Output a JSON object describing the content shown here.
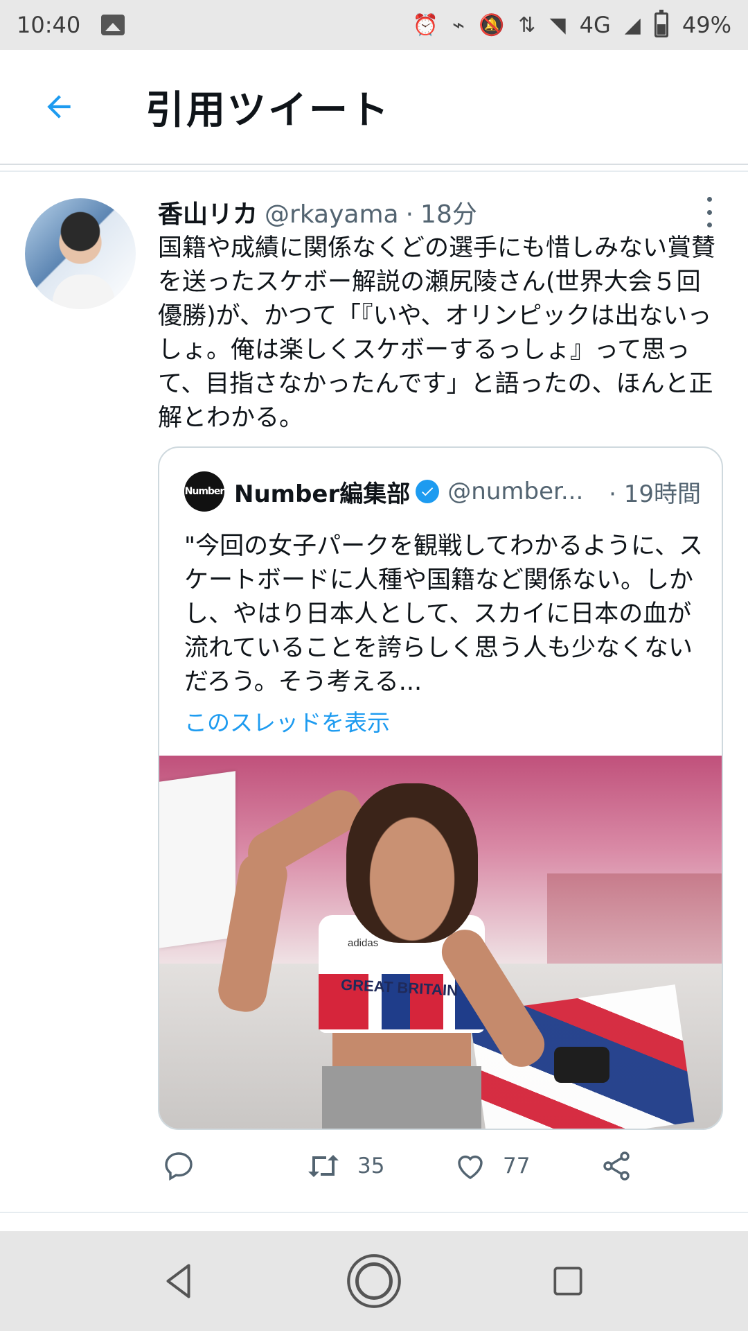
{
  "status_bar": {
    "time": "10:40",
    "network": "4G",
    "battery": "49%",
    "battery_level": 0.49,
    "icons": [
      "gallery-icon",
      "alarm-icon",
      "nfc-icon",
      "notifications-off-icon",
      "data-arrows-icon",
      "wifi-icon",
      "signal-icon",
      "battery-icon"
    ]
  },
  "header": {
    "title": "引用ツイート",
    "back_icon": "arrow-left-icon"
  },
  "tweet": {
    "author_name": "香山リカ",
    "author_handle": "@rkayama",
    "separator": "·",
    "time_ago": "18分",
    "text": "国籍や成績に関係なくどの選手にも惜しみない賞賛を送ったスケボー解説の瀬尻陵さん(世界大会５回優勝)が、かつて「『いや、オリンピックは出ないっしょ。俺は楽しくスケボーするっしょ』って思って、目指さなかったんです」と語ったの、ほんと正解とわかる。",
    "quoted": {
      "avatar_text": "Number",
      "author_name": "Number編集部",
      "author_handle": "@number...",
      "separator": "·",
      "time_ago": "19時間",
      "text": "\"今回の女子パークを観戦してわかるように、スケートボードに人種や国籍など関係ない。しかし、やはり日本人として、スカイに日本の血が流れていることを誇らしく思う人も少なくないだろう。そう考える...",
      "thread_link": "このスレッドを表示",
      "image_jersey_text": "GREAT BRITAIN",
      "image_logo_text": "adidas"
    },
    "actions": {
      "reply_count": "",
      "retweet_count": "35",
      "like_count": "77"
    }
  },
  "colors": {
    "accent": "#1d9bf0",
    "text": "#0f1419",
    "secondary": "#536471",
    "border": "#cfd9de"
  }
}
